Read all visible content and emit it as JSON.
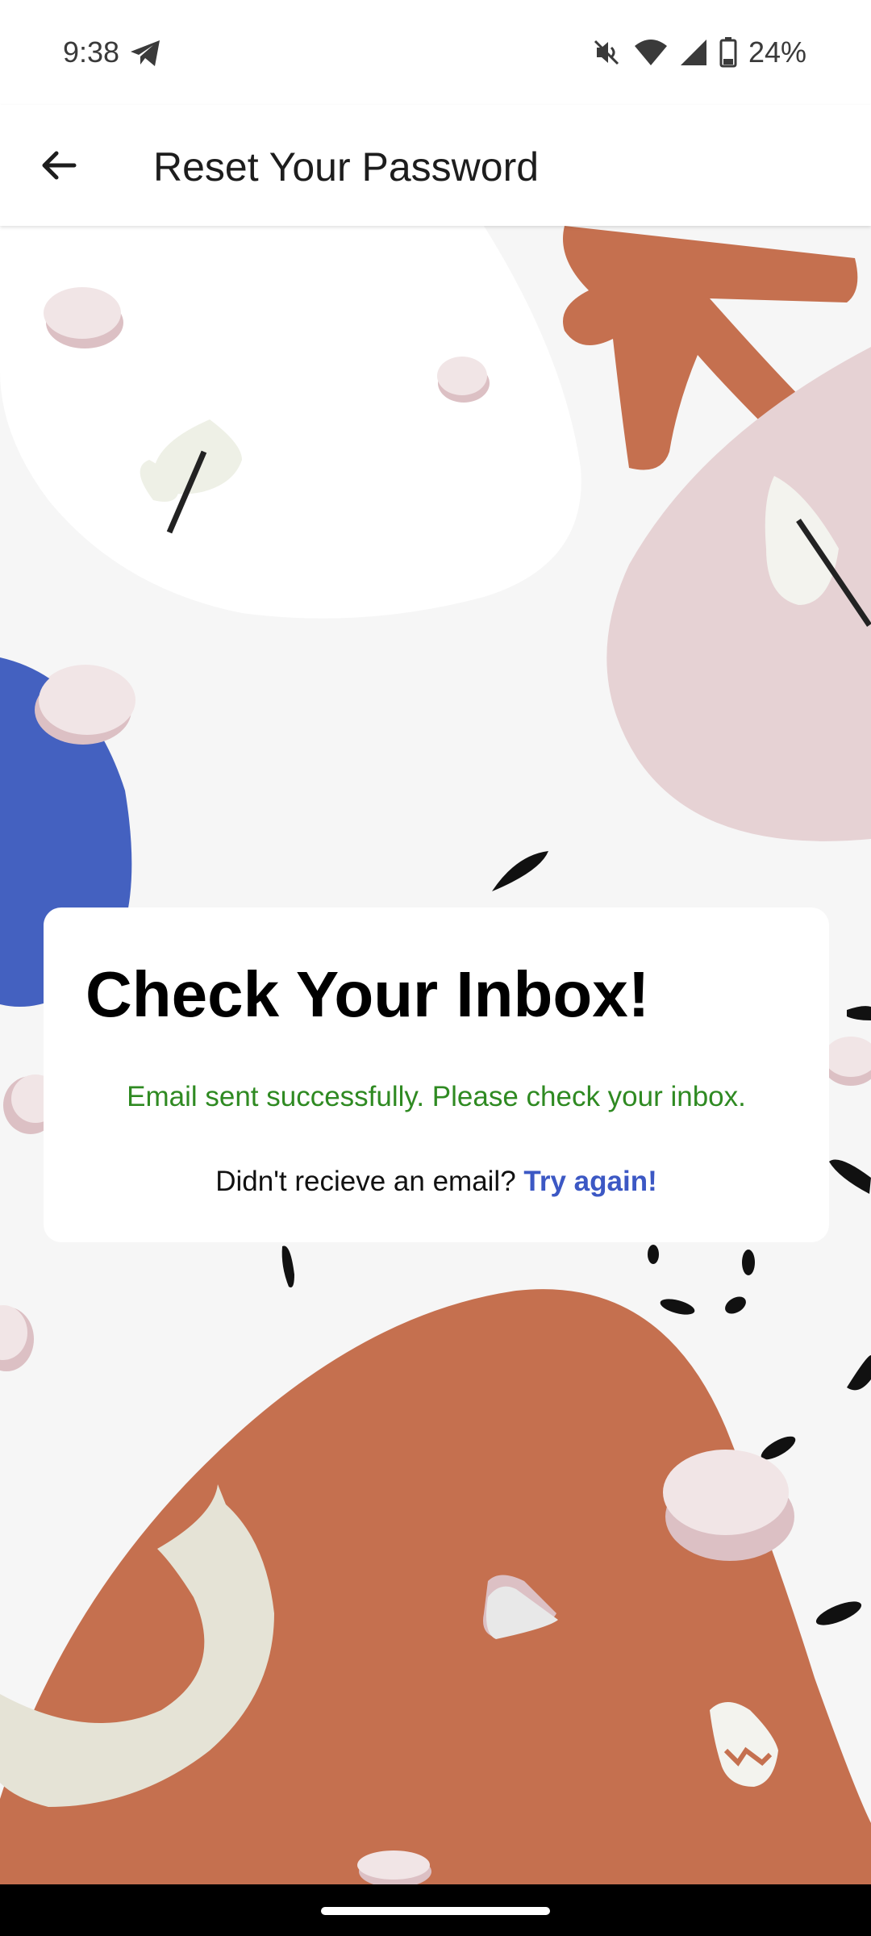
{
  "status_bar": {
    "time": "9:38",
    "battery": "24%",
    "icons": [
      "telegram-icon",
      "mute-icon",
      "wifi-icon",
      "signal-icon",
      "battery-icon"
    ]
  },
  "app_bar": {
    "title": "Reset Your Password",
    "back_icon": "arrow-back-icon"
  },
  "card": {
    "title": "Check Your Inbox!",
    "success_message": "Email sent successfully. Please check your inbox.",
    "retry_prompt": "Didn't recieve an email?",
    "retry_link": "Try again!"
  },
  "colors": {
    "success": "#2f8a22",
    "link": "#3c58c4",
    "terracotta": "#c5704f",
    "blush": "#e6d2d4",
    "blue": "#4461c0"
  }
}
